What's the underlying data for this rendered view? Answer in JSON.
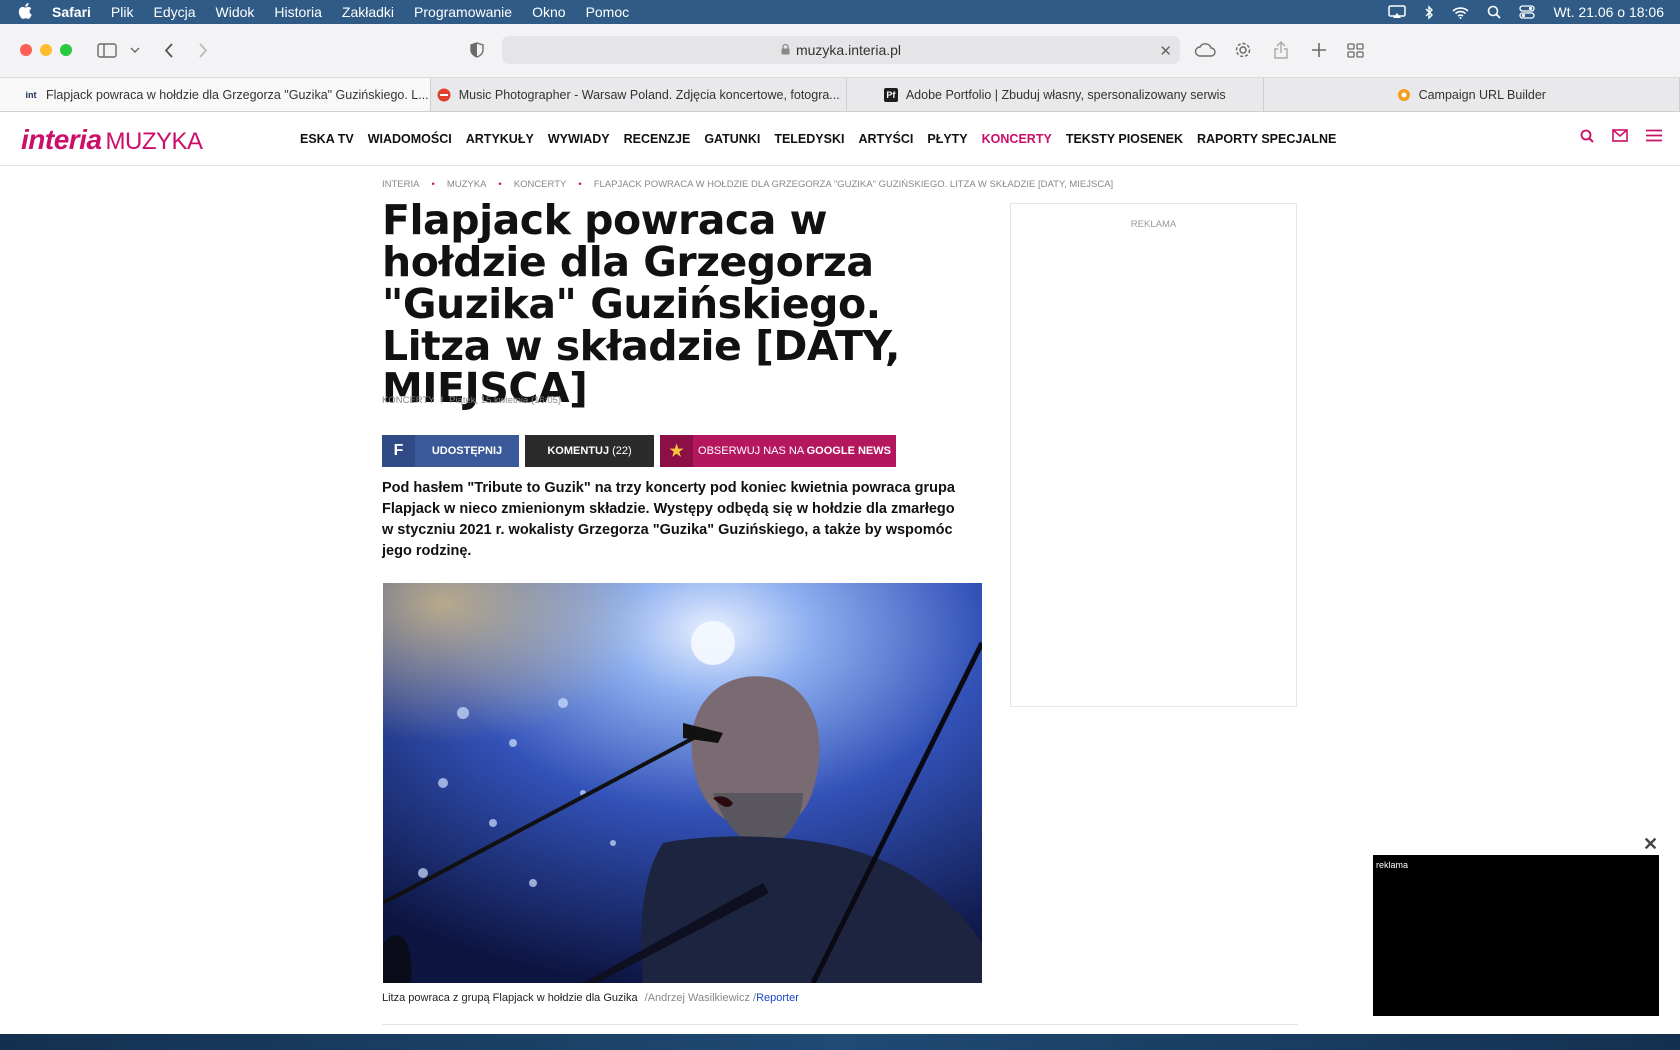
{
  "menubar": {
    "app": "Safari",
    "items": [
      "Plik",
      "Edycja",
      "Widok",
      "Historia",
      "Zakładki",
      "Programowanie",
      "Okno",
      "Pomoc"
    ],
    "clock": "Wt. 21.06 o 18:06"
  },
  "browser": {
    "url": "muzyka.interia.pl",
    "tabs": [
      {
        "label": "Flapjack powraca w hołdzie dla Grzegorza \"Guzika\" Guzińskiego. L...",
        "favicon": "int",
        "active": true
      },
      {
        "label": "Music Photographer - Warsaw Poland. Zdjęcia koncertowe, fotogra...",
        "favicon": "red-circle",
        "active": false
      },
      {
        "label": "Adobe Portfolio | Zbuduj własny, spersonalizowany serwis",
        "favicon": "Pf",
        "active": false
      },
      {
        "label": "Campaign URL Builder",
        "favicon": "orange-gear",
        "active": false
      }
    ]
  },
  "site": {
    "logo_brand": "interia",
    "logo_section": "MUZYKA",
    "nav": [
      "ESKA TV",
      "WIADOMOŚCI",
      "ARTYKUŁY",
      "WYWIADY",
      "RECENZJE",
      "GATUNKI",
      "TELEDYSKI",
      "ARTYŚCI",
      "PŁYTY",
      "KONCERTY",
      "TEKSTY PIOSENEK",
      "RAPORTY SPECJALNE"
    ],
    "nav_active": "KONCERTY",
    "accent": "#cb0f68"
  },
  "article": {
    "breadcrumb": [
      "INTERIA",
      "MUZYKA",
      "KONCERTY",
      "FLAPJACK POWRACA W HOŁDZIE DLA GRZEGORZA \"GUZIKA\" GUZIŃSKIEGO. LITZA W SKŁADZIE [DATY, MIEJSCA]"
    ],
    "title": "Flapjack powraca w hołdzie dla Grzegorza \"Guzika\" Guzińskiego. Litza w składzie [DATY, MIEJSCA]",
    "category": "KONCERTY",
    "date": "Piątek, 15 kwietnia (16:05)",
    "share_label": "UDOSTĘPNIJ",
    "comments_label": "KOMENTUJ",
    "comments_count": "(22)",
    "gnews_prefix": "OBSERWUJ NAS NA",
    "gnews_brand": "GOOGLE NEWS",
    "lead": "Pod hasłem \"Tribute to Guzik\" na trzy koncerty pod koniec kwietnia powraca grupa Flapjack w nieco zmienionym składzie. Występy odbędą się w hołdzie dla zmarłego w styczniu 2021 r. wokalisty Grzegorza \"Guzika\" Guzińskiego, a także by wspomóc jego rodzinę.",
    "caption": "Litza powraca z grupą Flapjack w hołdzie dla Guzika",
    "photo_author": "/Andrzej Wasilkiewicz /",
    "photo_agency": "Reporter"
  },
  "ads": {
    "sidebar_label": "REKLAMA",
    "video_label": "reklama"
  }
}
